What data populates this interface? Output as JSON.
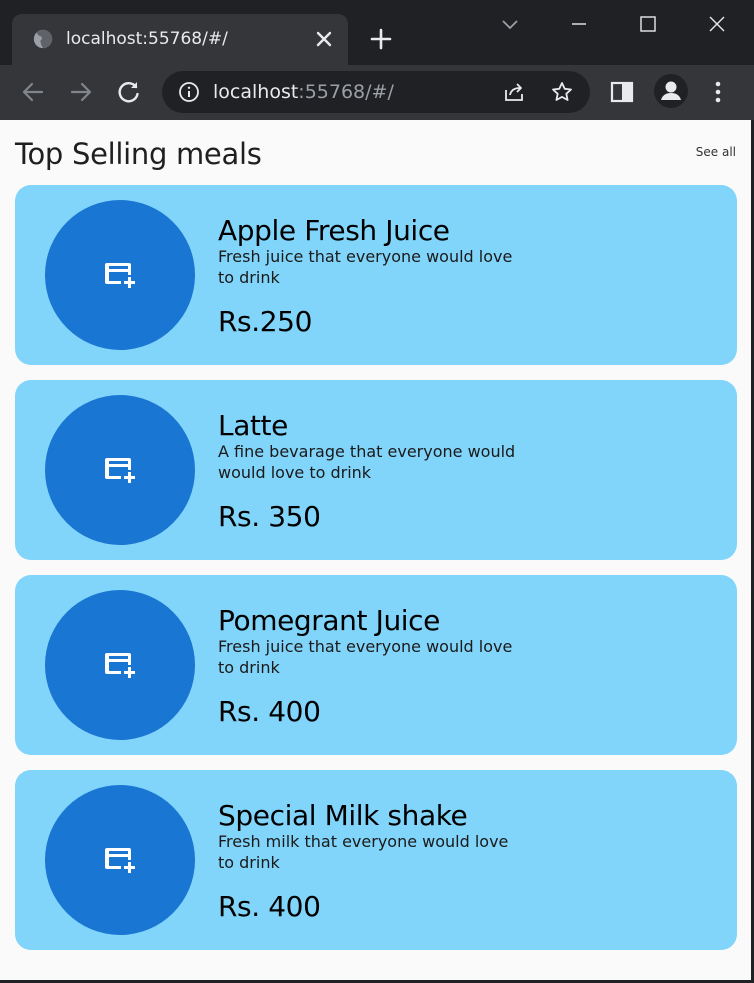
{
  "browser": {
    "tab_title": "localhost:55768/#/",
    "url_host": "localhost",
    "url_rest": ":55768/#/"
  },
  "page": {
    "section_title": "Top Selling meals",
    "see_all_label": "See all"
  },
  "meals": [
    {
      "name": "Apple Fresh Juice",
      "description": "Fresh juice that everyone would love to drink",
      "price": "Rs.250"
    },
    {
      "name": "Latte",
      "description": "A fine bevarage that everyone would would love to drink",
      "price": "Rs. 350"
    },
    {
      "name": "Pomegrant Juice",
      "description": "Fresh juice that everyone would love to drink",
      "price": "Rs. 400"
    },
    {
      "name": "Special Milk shake",
      "description": "Fresh milk that everyone would love to drink",
      "price": "Rs. 400"
    }
  ],
  "colors": {
    "card_background": "#81d4fa",
    "avatar_background": "#1976d2",
    "page_background": "#fafafa",
    "browser_chrome": "#35363a"
  },
  "icons": {
    "meal_avatar": "credit-card-add-icon"
  }
}
